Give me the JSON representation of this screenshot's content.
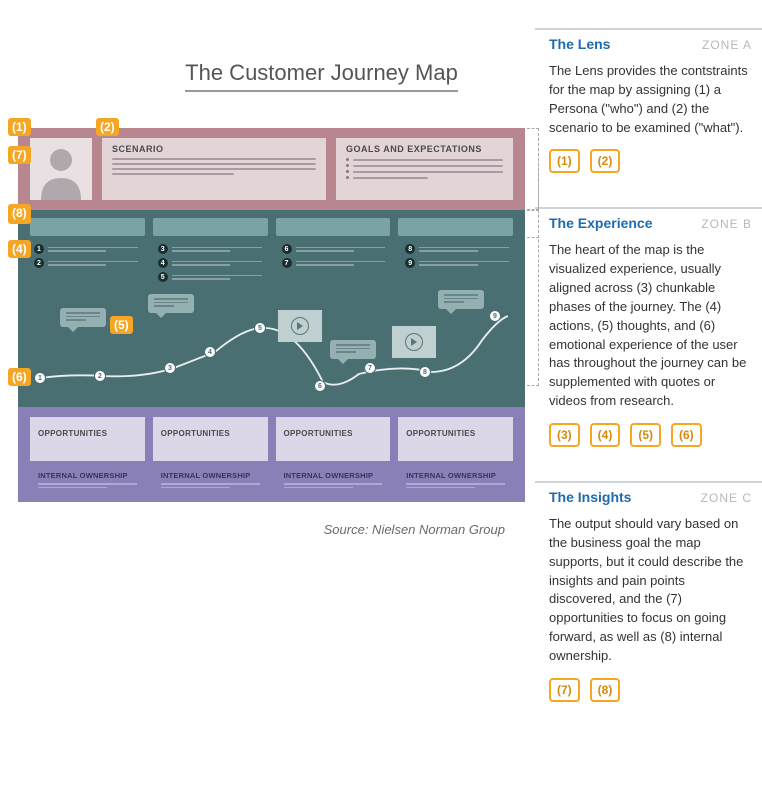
{
  "title": "The Customer Journey Map",
  "source": "Source: Nielsen Norman Group",
  "lens": {
    "scenario_label": "SCENARIO",
    "goals_label": "GOALS AND EXPECTATIONS"
  },
  "markers": {
    "m1": "(1)",
    "m2": "(2)",
    "m3": "(3)",
    "m4": "(4)",
    "m5": "(5)",
    "m6": "(6)",
    "m7": "(7)",
    "m8": "(8)"
  },
  "experience": {
    "action_numbers": [
      "1",
      "2",
      "3",
      "4",
      "5",
      "6",
      "7",
      "8",
      "9"
    ],
    "journey_nodes": [
      "1",
      "2",
      "3",
      "4",
      "5",
      "6",
      "7",
      "8",
      "9"
    ]
  },
  "insights": {
    "opportunities_label": "OPPORTUNITIES",
    "ownership_label": "INTERNAL OWNERSHIP"
  },
  "zones": [
    {
      "title": "The Lens",
      "tag": "ZONE A",
      "desc": "The Lens provides the contstraints for the map by assigning (1) a Persona (\"who\") and (2) the scenario to be examined (\"what\").",
      "markers": [
        "(1)",
        "(2)"
      ]
    },
    {
      "title": "The Experience",
      "tag": "ZONE B",
      "desc": "The heart of the map is the visualized experience, usually aligned across (3) chunkable phases of the journey. The (4) actions, (5) thoughts, and (6) emotional experience of the user has throughout the journey can be supplemented with quotes or videos from research.",
      "markers": [
        "(3)",
        "(4)",
        "(5)",
        "(6)"
      ]
    },
    {
      "title": "The Insights",
      "tag": "ZONE C",
      "desc": "The output should vary based on the business goal the map supports, but it could describe the insights and pain points discovered, and the (7) opportunities to focus on going forward, as well as (8) internal ownership.",
      "markers": [
        "(7)",
        "(8)"
      ]
    }
  ]
}
